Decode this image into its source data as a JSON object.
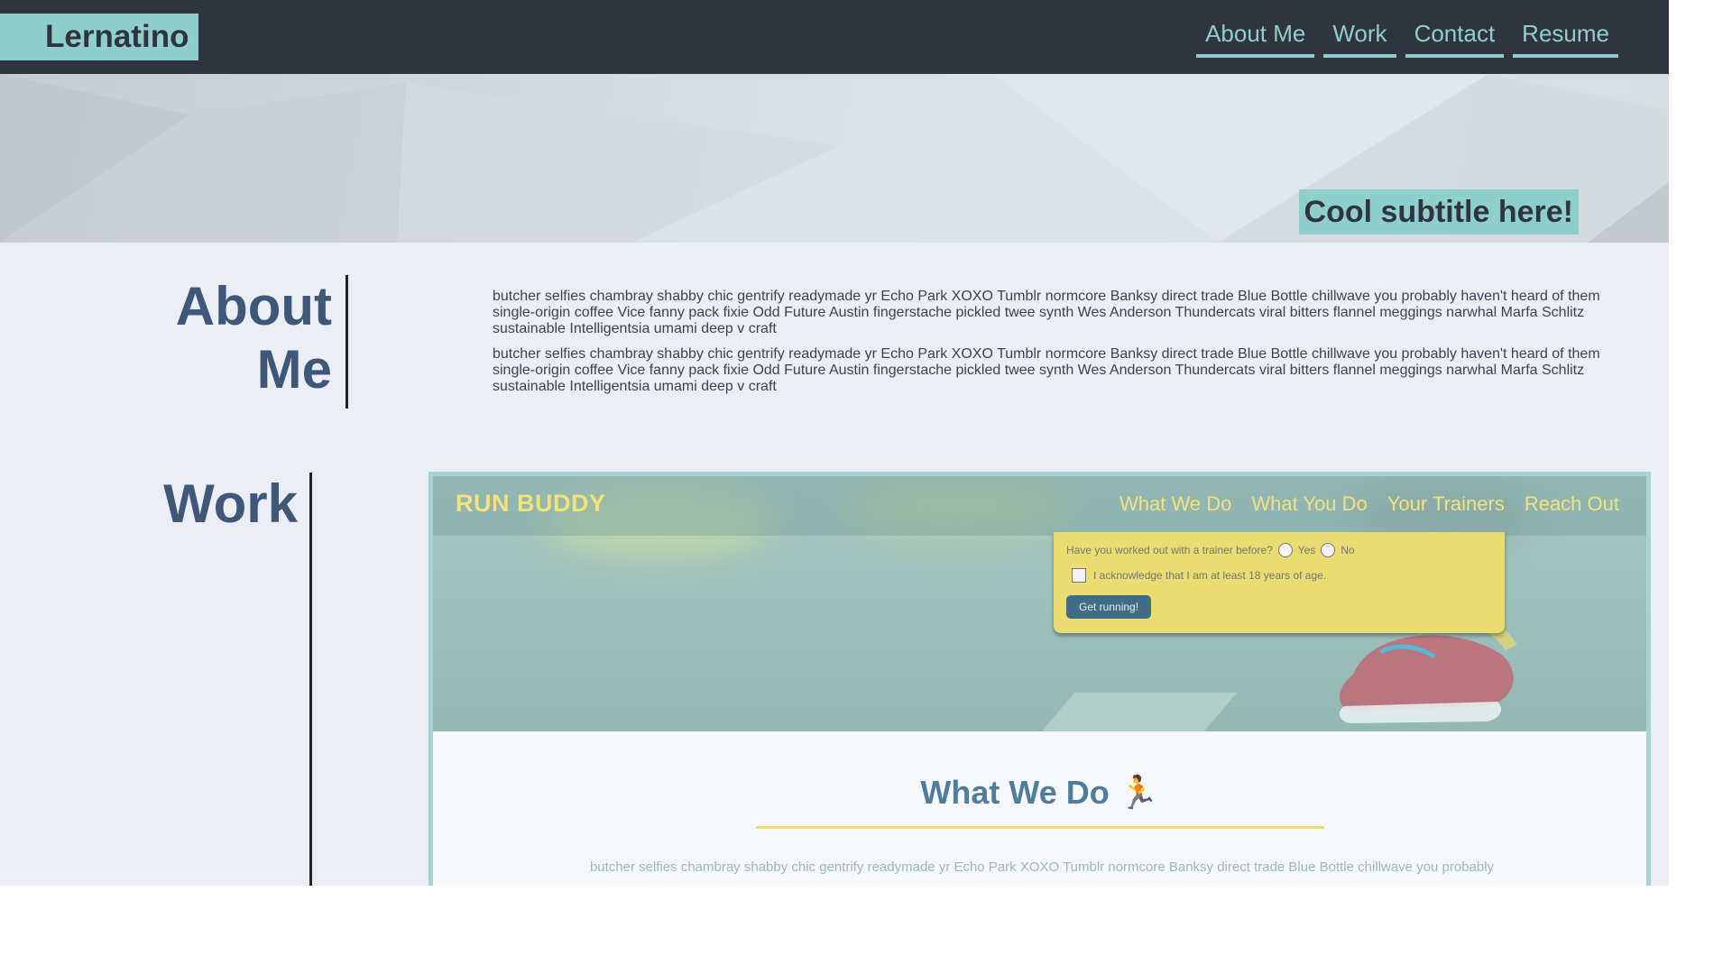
{
  "header": {
    "logo": "Lernatino",
    "nav": [
      {
        "label": "About Me"
      },
      {
        "label": "Work"
      },
      {
        "label": "Contact"
      },
      {
        "label": "Resume"
      }
    ]
  },
  "hero": {
    "subtitle": "Cool subtitle here!"
  },
  "about": {
    "heading_line1": "About",
    "heading_line2": "Me",
    "paragraphs": [
      "butcher selfies chambray shabby chic gentrify readymade yr Echo Park XOXO Tumblr normcore Banksy direct trade Blue Bottle chillwave you probably haven't heard of them single-origin coffee Vice fanny pack fixie Odd Future Austin fingerstache pickled twee synth Wes Anderson Thundercats viral bitters flannel meggings narwhal Marfa Schlitz sustainable Intelligentsia umami deep v craft",
      "butcher selfies chambray shabby chic gentrify readymade yr Echo Park XOXO Tumblr normcore Banksy direct trade Blue Bottle chillwave you probably haven't heard of them single-origin coffee Vice fanny pack fixie Odd Future Austin fingerstache pickled twee synth Wes Anderson Thundercats viral bitters flannel meggings narwhal Marfa Schlitz sustainable Intelligentsia umami deep v craft"
    ]
  },
  "work": {
    "heading": "Work",
    "project": {
      "brand": "RUN BUDDY",
      "nav": [
        {
          "label": "What We Do"
        },
        {
          "label": "What You Do"
        },
        {
          "label": "Your Trainers"
        },
        {
          "label": "Reach Out"
        }
      ],
      "form": {
        "question": "Have you worked out with a trainer before?",
        "yes": "Yes",
        "no": "No",
        "acknowledge": "I acknowledge that I am at least 18 years of age.",
        "button": "Get running!"
      },
      "section_title": "What We Do",
      "section_emoji": "🏃",
      "section_text": "butcher selfies chambray shabby chic gentrify readymade yr Echo Park XOXO Tumblr normcore Banksy direct trade Blue Bottle chillwave you probably"
    }
  },
  "colors": {
    "header_bg": "#30343f",
    "accent": "#8fcfcb",
    "heading": "#3f5779",
    "page_bg": "#eceef6",
    "project_yellow": "#eadc72"
  }
}
